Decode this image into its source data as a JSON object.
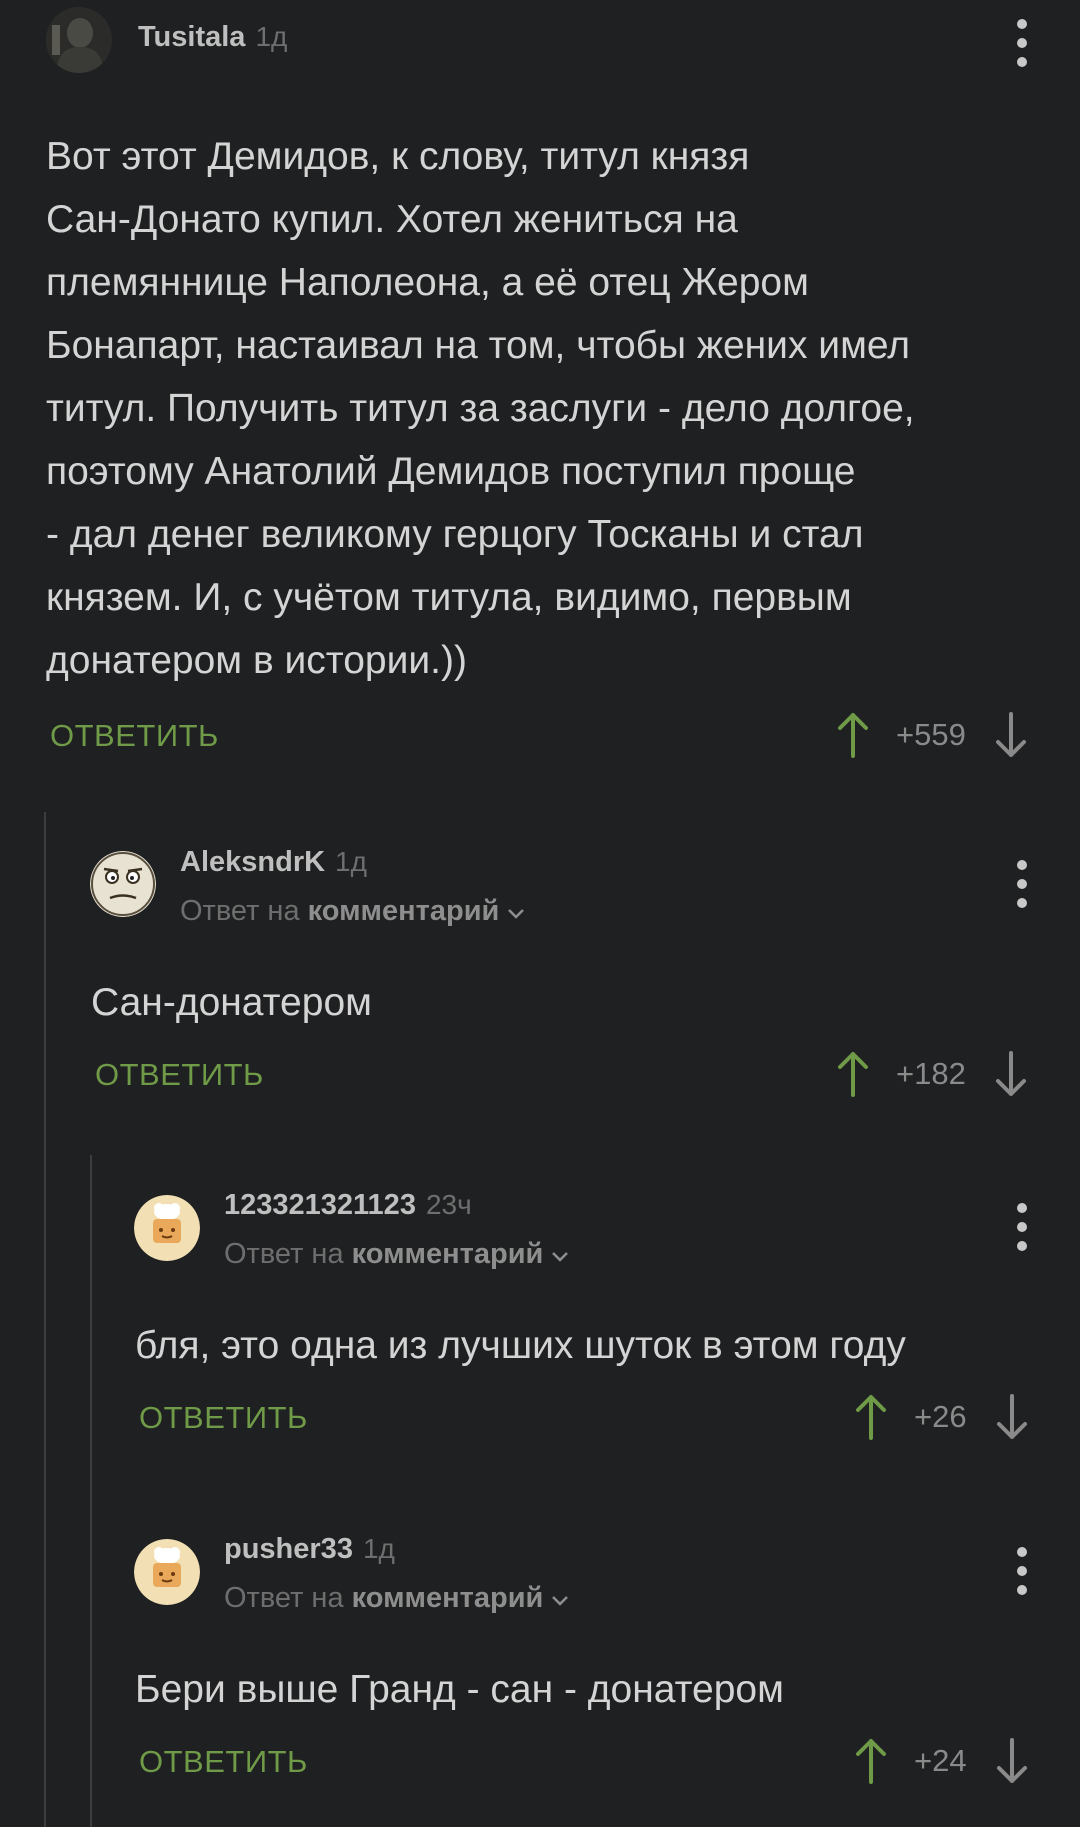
{
  "comments": [
    {
      "author": "Tusitala",
      "time": "1д",
      "text": "Вот этот Демидов, к слову, титул князя\nСан-Донато купил. Хотел жениться на\nплемяннице Наполеона, а её отец Жером\nБонапарт, настаивал на том, чтобы жених имел\nтитул. Получить титул за заслуги - дело долгое,\nпоэтому Анатолий Демидов поступил проще\n- дал денег великому герцогу Тосканы и стал\nкнязем. И, с учётом титула, видимо, первым\nдонатером в истории.))",
      "reply_label": "ОТВЕТИТЬ",
      "score": "+559"
    },
    {
      "author": "AleksndrK",
      "time": "1д",
      "reply_prefix": "Ответ на",
      "reply_target": "комментарий",
      "text": "Сан-донатером",
      "reply_label": "ОТВЕТИТЬ",
      "score": "+182"
    },
    {
      "author": "123321321123",
      "time": "23ч",
      "reply_prefix": "Ответ на",
      "reply_target": "комментарий",
      "text": "бля, это одна из лучших шуток в этом году",
      "reply_label": "ОТВЕТИТЬ",
      "score": "+26"
    },
    {
      "author": "pusher33",
      "time": "1д",
      "reply_prefix": "Ответ на",
      "reply_target": "комментарий",
      "text": "Бери выше Гранд - сан - донатером",
      "reply_label": "ОТВЕТИТЬ",
      "score": "+24"
    }
  ],
  "colors": {
    "background": "#1f2021",
    "accent_green": "#6f9a47",
    "muted_text": "#6e6e6e"
  },
  "icons": {
    "menu": "more-vertical-icon",
    "upvote": "arrow-up-icon",
    "downvote": "arrow-down-icon",
    "chevron": "chevron-down-icon"
  }
}
